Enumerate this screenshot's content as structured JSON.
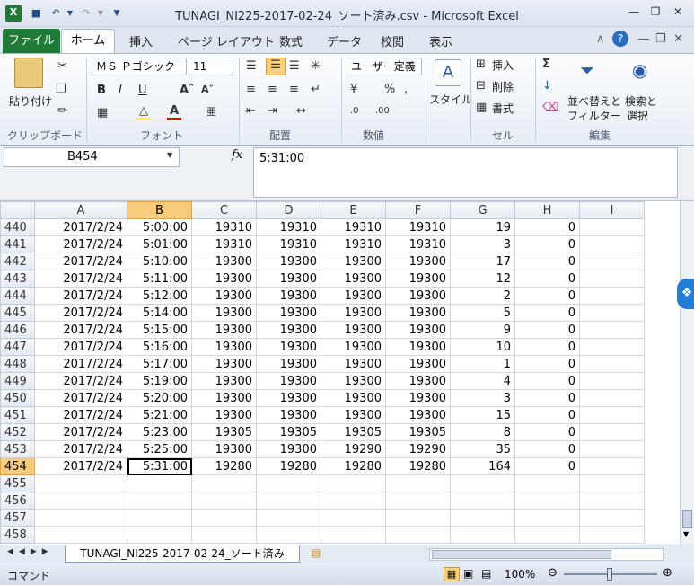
{
  "window": {
    "title": "TUNAGI_NI225-2017-02-24_ソート済み.csv - Microsoft Excel"
  },
  "tabs": [
    "ファイル",
    "ホーム",
    "挿入",
    "ページ レイアウト",
    "数式",
    "データ",
    "校閲",
    "表示"
  ],
  "ribbon": {
    "clipboard": {
      "paste": "貼り付け",
      "label": "クリップボード"
    },
    "font": {
      "name": "ＭＳ Ｐゴシック",
      "size": "11",
      "label": "フォント",
      "bold": "B",
      "italic": "I",
      "underline": "U"
    },
    "alignment": {
      "label": "配置"
    },
    "number": {
      "format": "ユーザー定義",
      "label": "数値"
    },
    "styles": {
      "button": "スタイル"
    },
    "cells": {
      "insert": "挿入",
      "delete": "削除",
      "format": "書式",
      "label": "セル"
    },
    "editing": {
      "sort": "並べ替えと",
      "filter": "フィルター",
      "find": "検索と",
      "select": "選択",
      "label": "編集"
    }
  },
  "namebox": "B454",
  "fx": "fx",
  "formula": "5:31:00",
  "columns": [
    "A",
    "B",
    "C",
    "D",
    "E",
    "F",
    "G",
    "H",
    "I"
  ],
  "rows": [
    {
      "n": "440",
      "cells": [
        "2017/2/24",
        "5:00:00",
        "19310",
        "19310",
        "19310",
        "19310",
        "19",
        "0"
      ]
    },
    {
      "n": "441",
      "cells": [
        "2017/2/24",
        "5:01:00",
        "19310",
        "19310",
        "19310",
        "19310",
        "3",
        "0"
      ]
    },
    {
      "n": "442",
      "cells": [
        "2017/2/24",
        "5:10:00",
        "19300",
        "19300",
        "19300",
        "19300",
        "17",
        "0"
      ]
    },
    {
      "n": "443",
      "cells": [
        "2017/2/24",
        "5:11:00",
        "19300",
        "19300",
        "19300",
        "19300",
        "12",
        "0"
      ]
    },
    {
      "n": "444",
      "cells": [
        "2017/2/24",
        "5:12:00",
        "19300",
        "19300",
        "19300",
        "19300",
        "2",
        "0"
      ]
    },
    {
      "n": "445",
      "cells": [
        "2017/2/24",
        "5:14:00",
        "19300",
        "19300",
        "19300",
        "19300",
        "5",
        "0"
      ]
    },
    {
      "n": "446",
      "cells": [
        "2017/2/24",
        "5:15:00",
        "19300",
        "19300",
        "19300",
        "19300",
        "9",
        "0"
      ]
    },
    {
      "n": "447",
      "cells": [
        "2017/2/24",
        "5:16:00",
        "19300",
        "19300",
        "19300",
        "19300",
        "10",
        "0"
      ]
    },
    {
      "n": "448",
      "cells": [
        "2017/2/24",
        "5:17:00",
        "19300",
        "19300",
        "19300",
        "19300",
        "1",
        "0"
      ]
    },
    {
      "n": "449",
      "cells": [
        "2017/2/24",
        "5:19:00",
        "19300",
        "19300",
        "19300",
        "19300",
        "4",
        "0"
      ]
    },
    {
      "n": "450",
      "cells": [
        "2017/2/24",
        "5:20:00",
        "19300",
        "19300",
        "19300",
        "19300",
        "3",
        "0"
      ]
    },
    {
      "n": "451",
      "cells": [
        "2017/2/24",
        "5:21:00",
        "19300",
        "19300",
        "19300",
        "19300",
        "15",
        "0"
      ]
    },
    {
      "n": "452",
      "cells": [
        "2017/2/24",
        "5:23:00",
        "19305",
        "19305",
        "19305",
        "19305",
        "8",
        "0"
      ]
    },
    {
      "n": "453",
      "cells": [
        "2017/2/24",
        "5:25:00",
        "19300",
        "19300",
        "19290",
        "19290",
        "35",
        "0"
      ]
    },
    {
      "n": "454",
      "cells": [
        "2017/2/24",
        "5:31:00",
        "19280",
        "19280",
        "19280",
        "19280",
        "164",
        "0"
      ]
    },
    {
      "n": "455",
      "cells": [
        "",
        "",
        "",
        "",
        "",
        "",
        "",
        ""
      ]
    },
    {
      "n": "456",
      "cells": [
        "",
        "",
        "",
        "",
        "",
        "",
        "",
        ""
      ]
    },
    {
      "n": "457",
      "cells": [
        "",
        "",
        "",
        "",
        "",
        "",
        "",
        ""
      ]
    },
    {
      "n": "458",
      "cells": [
        "",
        "",
        "",
        "",
        "",
        "",
        "",
        ""
      ]
    }
  ],
  "sheet_tab": "TUNAGI_NI225-2017-02-24_ソート済み",
  "status": {
    "mode": "コマンド",
    "zoom": "100%"
  },
  "colors": {
    "accent": "#1f7a35",
    "selected_header": "#f8cc7a"
  }
}
